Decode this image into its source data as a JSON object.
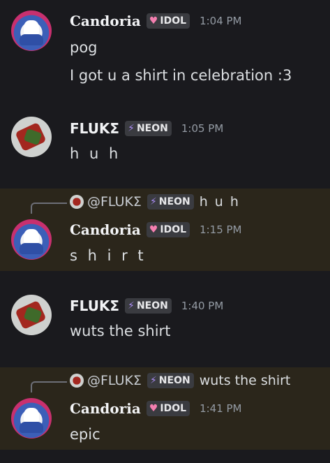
{
  "messages": [
    {
      "author": "Candoria",
      "badge_icon": "heart-icon",
      "badge_label": "IDOL",
      "time": "1:04 PM",
      "lines": [
        "pog",
        "I got u a shirt in celebration :3"
      ]
    },
    {
      "author": "FLUKΣ",
      "badge_icon": "lightning-icon",
      "badge_label": "NEON",
      "time": "1:05 PM",
      "lines": [
        "h u h"
      ]
    },
    {
      "reply": {
        "mention": "@FLUKΣ",
        "badge_label": "NEON",
        "text": "h u h"
      },
      "author": "Candoria",
      "badge_label": "IDOL",
      "time": "1:15 PM",
      "lines": [
        "s h i r t"
      ]
    },
    {
      "author": "FLUKΣ",
      "badge_label": "NEON",
      "time": "1:40 PM",
      "lines": [
        "wuts the shirt"
      ]
    },
    {
      "reply": {
        "mention": "@FLUKΣ",
        "badge_label": "NEON",
        "text": "wuts the shirt"
      },
      "author": "Candoria",
      "badge_label": "IDOL",
      "time": "1:41 PM",
      "lines": [
        "epic"
      ]
    }
  ],
  "colors": {
    "background": "#1a1a1e",
    "highlight": "#2b261b",
    "heart": "#f47fb0",
    "bolt": "#a98bf2"
  }
}
